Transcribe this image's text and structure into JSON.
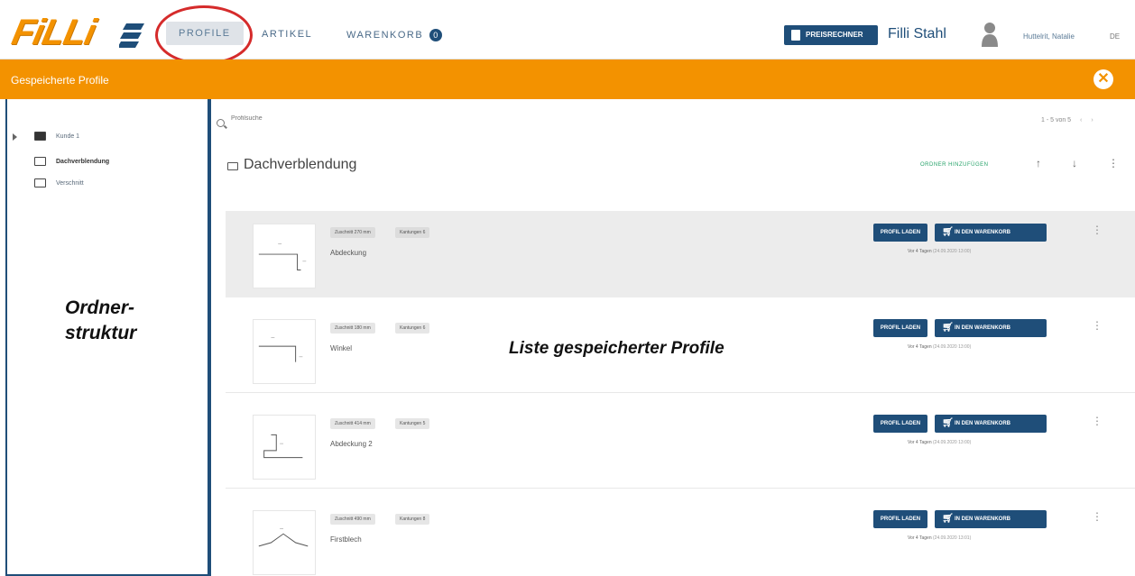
{
  "header": {
    "logo_text": "FiLLi",
    "tabs": [
      {
        "label": "PROFILE",
        "active": true
      },
      {
        "label": "ARTIKEL",
        "active": false
      },
      {
        "label": "WARENKORB",
        "active": false,
        "badge": "0"
      }
    ],
    "calculator_button": "PREISRECHNER",
    "company": "Filli Stahl",
    "user_name": "Huttelrit, Natalie",
    "language": "DE"
  },
  "titlebar": {
    "title": "Gespeicherte Profile",
    "close_icon": "close-icon"
  },
  "sidebar": {
    "tree": [
      {
        "label": "Kunde 1",
        "expandable": true,
        "filled": true
      },
      {
        "label": "Dachverblendung",
        "bold": true
      },
      {
        "label": "Verschnitt"
      }
    ],
    "annotation": [
      "Ordner-",
      "struktur"
    ]
  },
  "main": {
    "search_placeholder": "Profilsuche",
    "pager": "1 - 5 von 5",
    "folder_title": "Dachverblendung",
    "add_folder_label": "ORDNER HINZUFÜGEN",
    "annotation": "Liste gespeicherter Profile",
    "load_label": "PROFIL LADEN",
    "cart_label": "IN DEN WARENKORB",
    "profiles": [
      {
        "cut": "Zuschnitt 270 mm",
        "bends": "Kantungen 6",
        "name": "Abdeckung",
        "age": "Vor 4 Tagen",
        "date": "(24.09.2020 13:00)"
      },
      {
        "cut": "Zuschnitt 180 mm",
        "bends": "Kantungen 6",
        "name": "Winkel",
        "age": "Vor 4 Tagen",
        "date": "(24.09.2020 13:00)"
      },
      {
        "cut": "Zuschnitt 414 mm",
        "bends": "Kantungen 5",
        "name": "Abdeckung 2",
        "age": "Vor 4 Tagen",
        "date": "(24.09.2020 13:00)"
      },
      {
        "cut": "Zuschnitt 490 mm",
        "bends": "Kantungen 8",
        "name": "Firstblech",
        "age": "Vor 4 Tagen",
        "date": "(24.09.2020 13:01)"
      }
    ]
  },
  "colors": {
    "accent": "#f39200",
    "primary": "#1f4e79",
    "highlight": "#d52b2b"
  }
}
